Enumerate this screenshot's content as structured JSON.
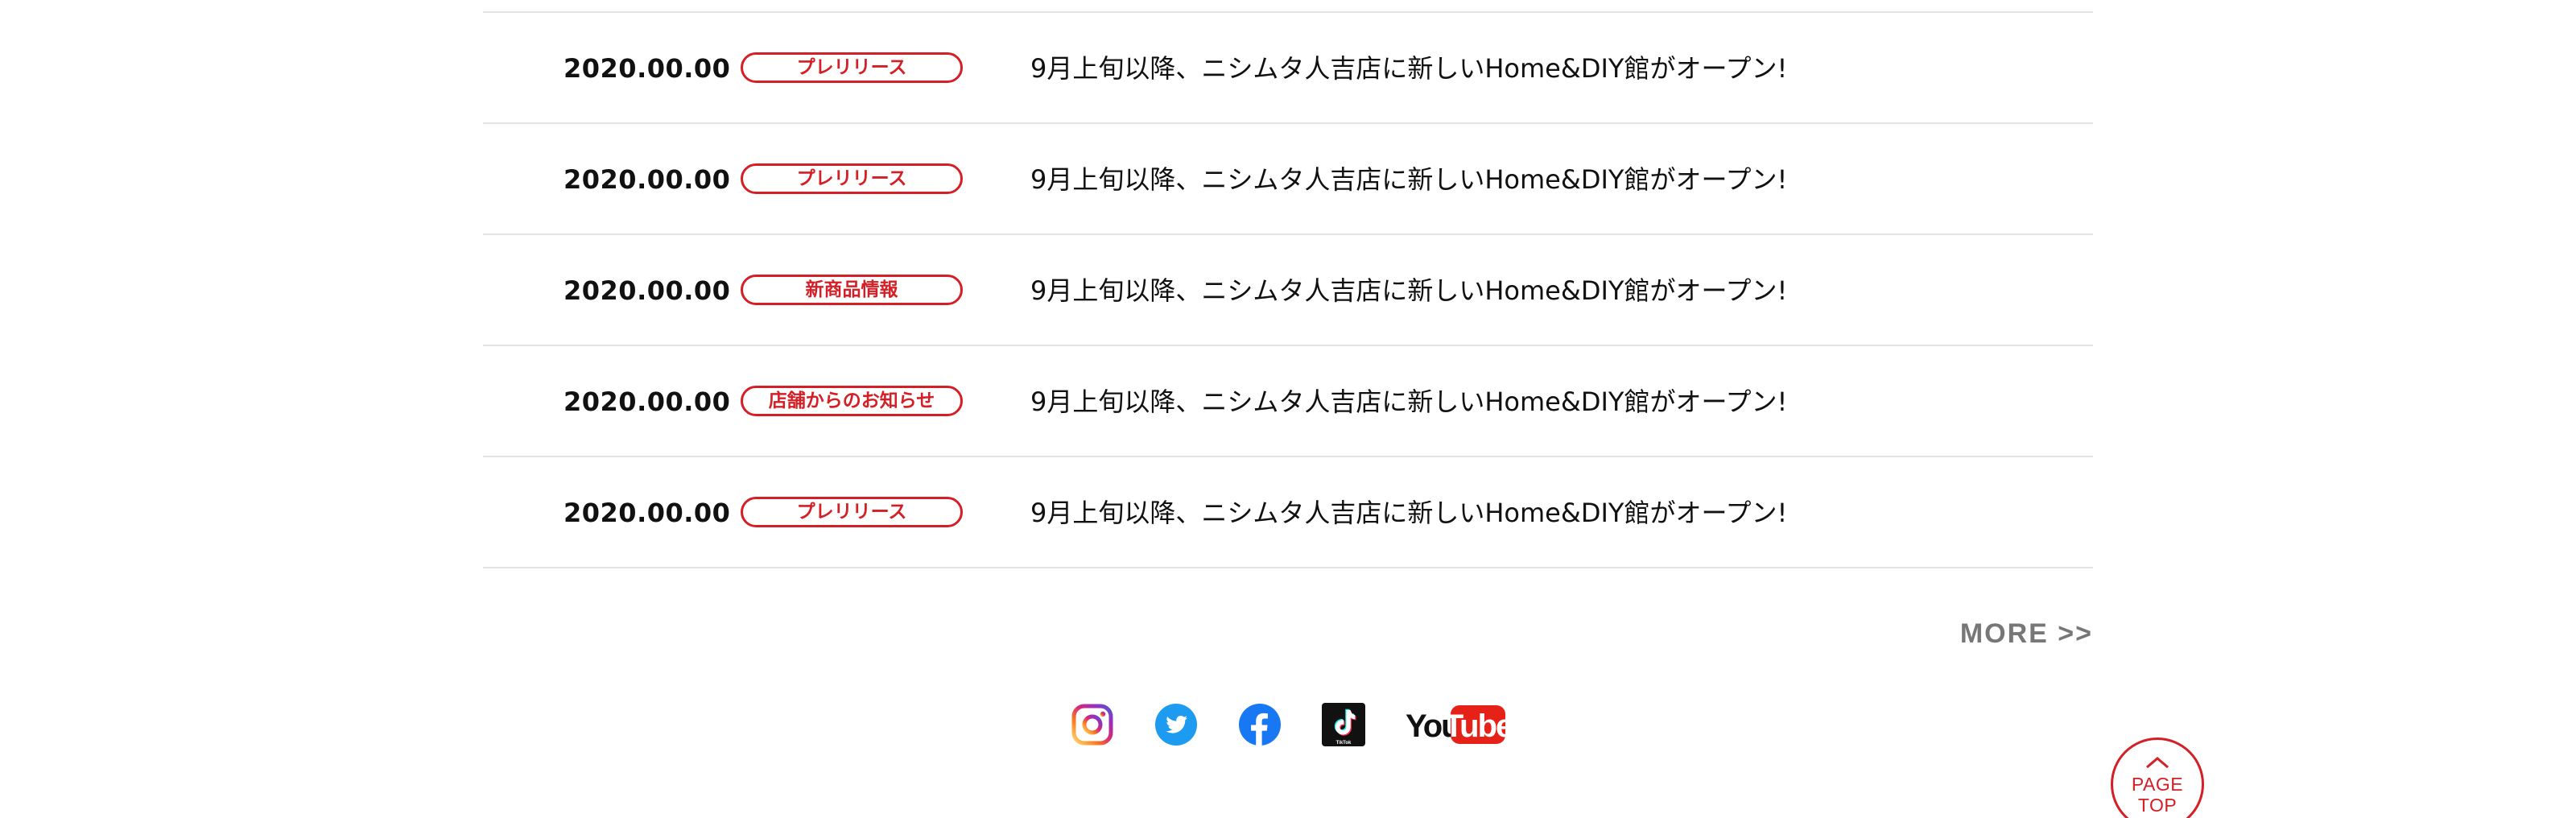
{
  "news": {
    "items": [
      {
        "date": "2020.00.00",
        "tag": "プレリリース",
        "title": "9月上旬以降、ニシムタ人吉店に新しいHome&DIY館がオープン!"
      },
      {
        "date": "2020.00.00",
        "tag": "プレリリース",
        "title": "9月上旬以降、ニシムタ人吉店に新しいHome&DIY館がオープン!"
      },
      {
        "date": "2020.00.00",
        "tag": "新商品情報",
        "title": "9月上旬以降、ニシムタ人吉店に新しいHome&DIY館がオープン!"
      },
      {
        "date": "2020.00.00",
        "tag": "店舗からのお知らせ",
        "title": "9月上旬以降、ニシムタ人吉店に新しいHome&DIY館がオープン!"
      },
      {
        "date": "2020.00.00",
        "tag": "プレリリース",
        "title": "9月上旬以降、ニシムタ人吉店に新しいHome&DIY館がオープン!"
      }
    ],
    "more_label": "MORE >>"
  },
  "social": {
    "icons": [
      "instagram-icon",
      "twitter-icon",
      "facebook-icon",
      "tiktok-icon",
      "youtube-icon"
    ],
    "youtube_you": "You",
    "youtube_tube": "Tube",
    "tiktok_label": "TikTok"
  },
  "page_top": {
    "line1": "PAGE",
    "line2": "TOP"
  },
  "colors": {
    "accent": "#d31f25",
    "text": "#111111",
    "muted": "#777777",
    "divider": "#e4e4e4",
    "twitter": "#1d9bf0",
    "facebook": "#1877f2",
    "youtube": "#e62117"
  }
}
